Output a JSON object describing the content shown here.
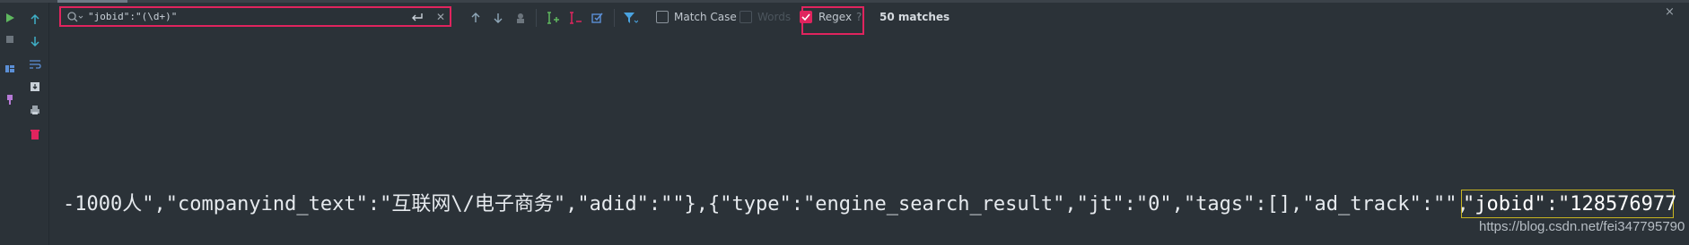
{
  "find_bar": {
    "query": "\"jobid\":\"(\\d+)\"",
    "match_case_label": "Match Case",
    "match_case_checked": false,
    "words_label": "Words",
    "words_checked": false,
    "words_enabled": false,
    "regex_label": "Regex",
    "regex_checked": true,
    "regex_help": "?",
    "match_count": "50 matches",
    "close_label": "×"
  },
  "editor": {
    "line_text": "-1000人\",\"companyind_text\":\"互联网\\/电子商务\",\"adid\":\"\"},{\"type\":\"engine_search_result\",\"jt\":\"0\",\"tags\":[],\"ad_track\":\"\",",
    "highlight_text": "\"jobid\":\"128576977"
  },
  "watermark": "https://blog.csdn.net/fei347795790",
  "colors": {
    "accent": "#e0245e",
    "background": "#2b3238",
    "match_highlight": "#c8b420"
  }
}
